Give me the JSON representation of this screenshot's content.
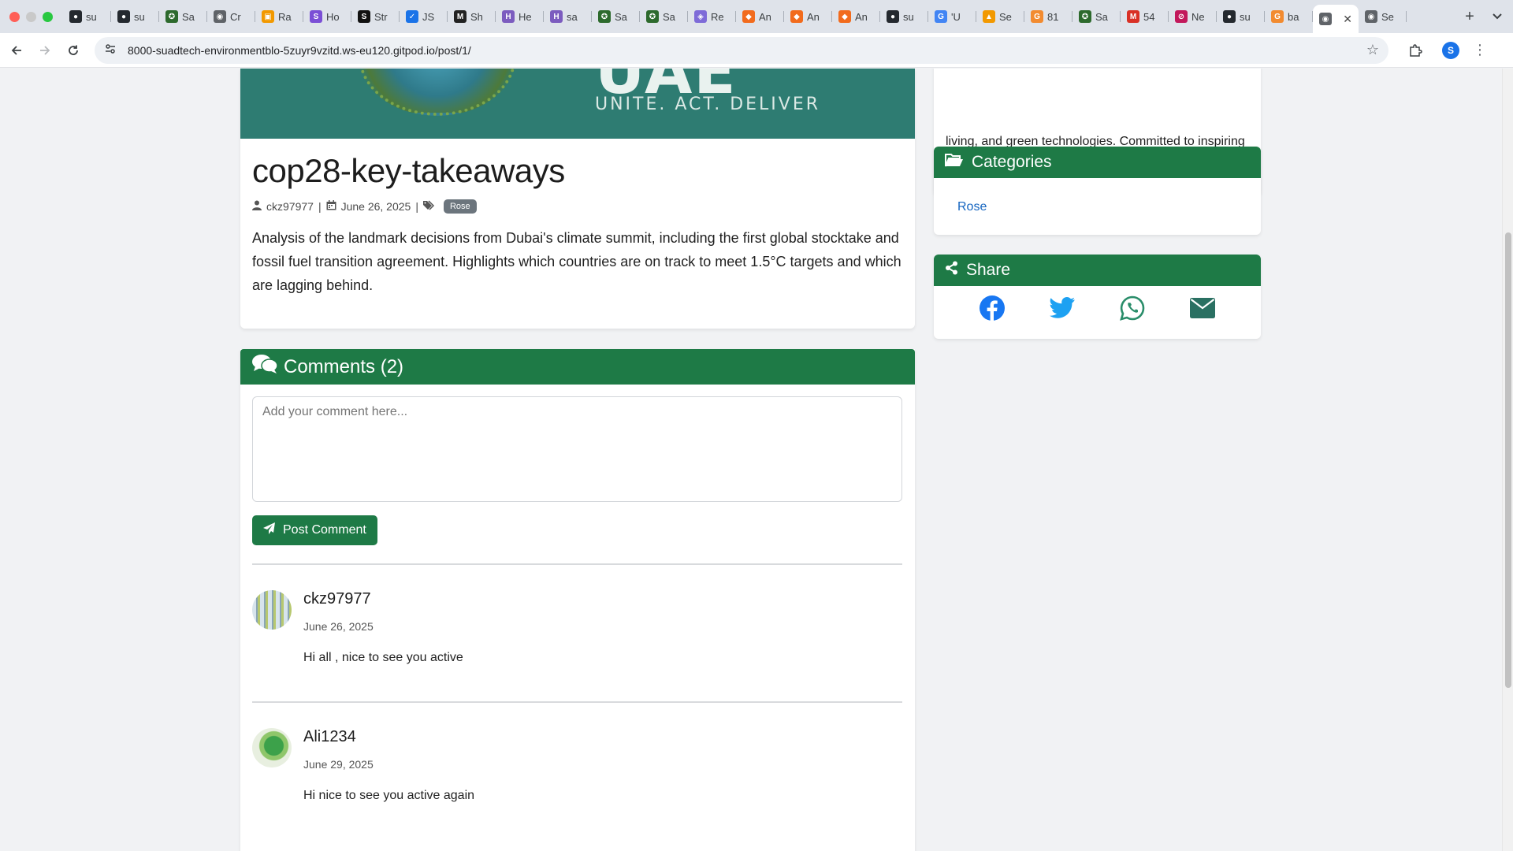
{
  "browser": {
    "tabs": [
      {
        "label": "su",
        "icon": "github-icon",
        "color": "#24292f"
      },
      {
        "label": "su",
        "icon": "github-icon",
        "color": "#24292f"
      },
      {
        "label": "Sa",
        "icon": "star-icon",
        "color": "#2d6a2d"
      },
      {
        "label": "Cr",
        "icon": "globe-icon",
        "color": "#5f6368"
      },
      {
        "label": "Ra",
        "icon": "image-icon",
        "color": "#f29900"
      },
      {
        "label": "Ho",
        "icon": "s-icon",
        "color": "#7b4fd6"
      },
      {
        "label": "Str",
        "icon": "s-black-icon",
        "color": "#111111"
      },
      {
        "label": "JS",
        "icon": "check-icon",
        "color": "#1a73e8"
      },
      {
        "label": "Sh",
        "icon": "m-icon",
        "color": "#222222"
      },
      {
        "label": "He",
        "icon": "h-icon",
        "color": "#7c5cbf"
      },
      {
        "label": "sa",
        "icon": "h-icon",
        "color": "#7c5cbf"
      },
      {
        "label": "Sa",
        "icon": "star-icon",
        "color": "#2d6a2d"
      },
      {
        "label": "Sa",
        "icon": "star-icon",
        "color": "#2d6a2d"
      },
      {
        "label": "Re",
        "icon": "cube-icon",
        "color": "#7e6bd8"
      },
      {
        "label": "An",
        "icon": "box-icon",
        "color": "#f26b1d"
      },
      {
        "label": "An",
        "icon": "box-icon",
        "color": "#f26b1d"
      },
      {
        "label": "An",
        "icon": "box-icon",
        "color": "#f26b1d"
      },
      {
        "label": "su",
        "icon": "github-icon",
        "color": "#24292f"
      },
      {
        "label": "'U",
        "icon": "google-icon",
        "color": "#4285f4"
      },
      {
        "label": "Se",
        "icon": "chart-icon",
        "color": "#f29900"
      },
      {
        "label": "81",
        "icon": "g-icon",
        "color": "#f28b30"
      },
      {
        "label": "Sa",
        "icon": "star-icon",
        "color": "#2d6a2d"
      },
      {
        "label": "54",
        "icon": "gmail-icon",
        "color": "#d93025"
      },
      {
        "label": "Ne",
        "icon": "no-icon",
        "color": "#c2185b"
      },
      {
        "label": "su",
        "icon": "github-icon",
        "color": "#24292f"
      },
      {
        "label": "ba",
        "icon": "g-icon",
        "color": "#f28b30"
      }
    ],
    "active_tab": {
      "label": "",
      "icon": "globe-icon"
    },
    "last_tab": {
      "label": "Se",
      "icon": "globe-icon"
    },
    "url": "8000-suadtech-environmentblo-5zuyr9vzitd.ws-eu120.gitpod.io/post/1/",
    "profile_initial": "S"
  },
  "post": {
    "hero_big_text": "UAE",
    "hero_slogan": "UNITE. ACT. DELIVER",
    "title": "cop28-key-takeaways",
    "author": "ckz97977",
    "date": "June 26, 2025",
    "separator": "|",
    "tag": "Rose",
    "body": "Analysis of the landmark decisions from Dubai's climate summit, including the first global stocktake and fossil fuel transition agreement. Highlights which countries are on track to meet 1.5°C targets and which are lagging behind."
  },
  "comments": {
    "header": "Comments (2)",
    "placeholder": "Add your comment here...",
    "post_button": "Post Comment",
    "items": [
      {
        "author": "ckz97977",
        "date": "June 26, 2025",
        "text": "Hi all , nice to see you active"
      },
      {
        "author": "Ali1234",
        "date": "June 29, 2025",
        "text": "Hi nice to see you active again"
      }
    ]
  },
  "sidebar": {
    "about_text": "living, and green technologies. Committed to inspiring others to protect our environment.",
    "categories_title": "Categories",
    "categories": [
      "Rose"
    ],
    "share_title": "Share",
    "share_icons": [
      "facebook-icon",
      "twitter-icon",
      "whatsapp-icon",
      "email-icon"
    ]
  },
  "colors": {
    "brand_green": "#1e7a46",
    "link_blue": "#1565c0",
    "facebook": "#1877f2",
    "twitter": "#1da1f2",
    "whatsapp": "#2a8d6a",
    "email": "#2a7062"
  }
}
